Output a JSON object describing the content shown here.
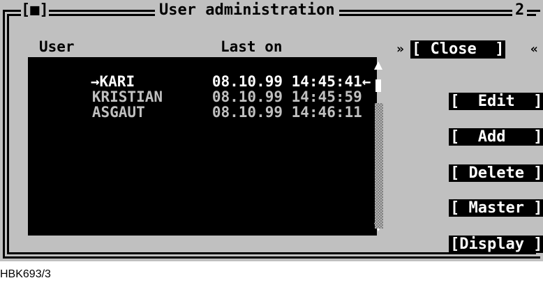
{
  "window": {
    "control_box": "[■]",
    "title": "User administration",
    "number": "2"
  },
  "list": {
    "columns": [
      "User",
      "Last on"
    ],
    "rows": [
      {
        "user": "KARI",
        "last_on": "08.10.99 14:45:41",
        "selected": true
      },
      {
        "user": "KRISTIAN",
        "last_on": "08.10.99 14:45:59",
        "selected": false
      },
      {
        "user": "ASGAUT",
        "last_on": "08.10.99 14:46:11",
        "selected": false
      }
    ],
    "selected_marker_left": "→",
    "selected_marker_right": "←"
  },
  "buttons": {
    "close": "[ Close  ]",
    "edit": "[  Edit  ]",
    "add": "[  Add   ]",
    "delete": "[ Delete ]",
    "master": "[ Master ]",
    "display": "[Display ]",
    "focus_left": "»",
    "focus_right": "«"
  },
  "caption": "HBK693/3"
}
